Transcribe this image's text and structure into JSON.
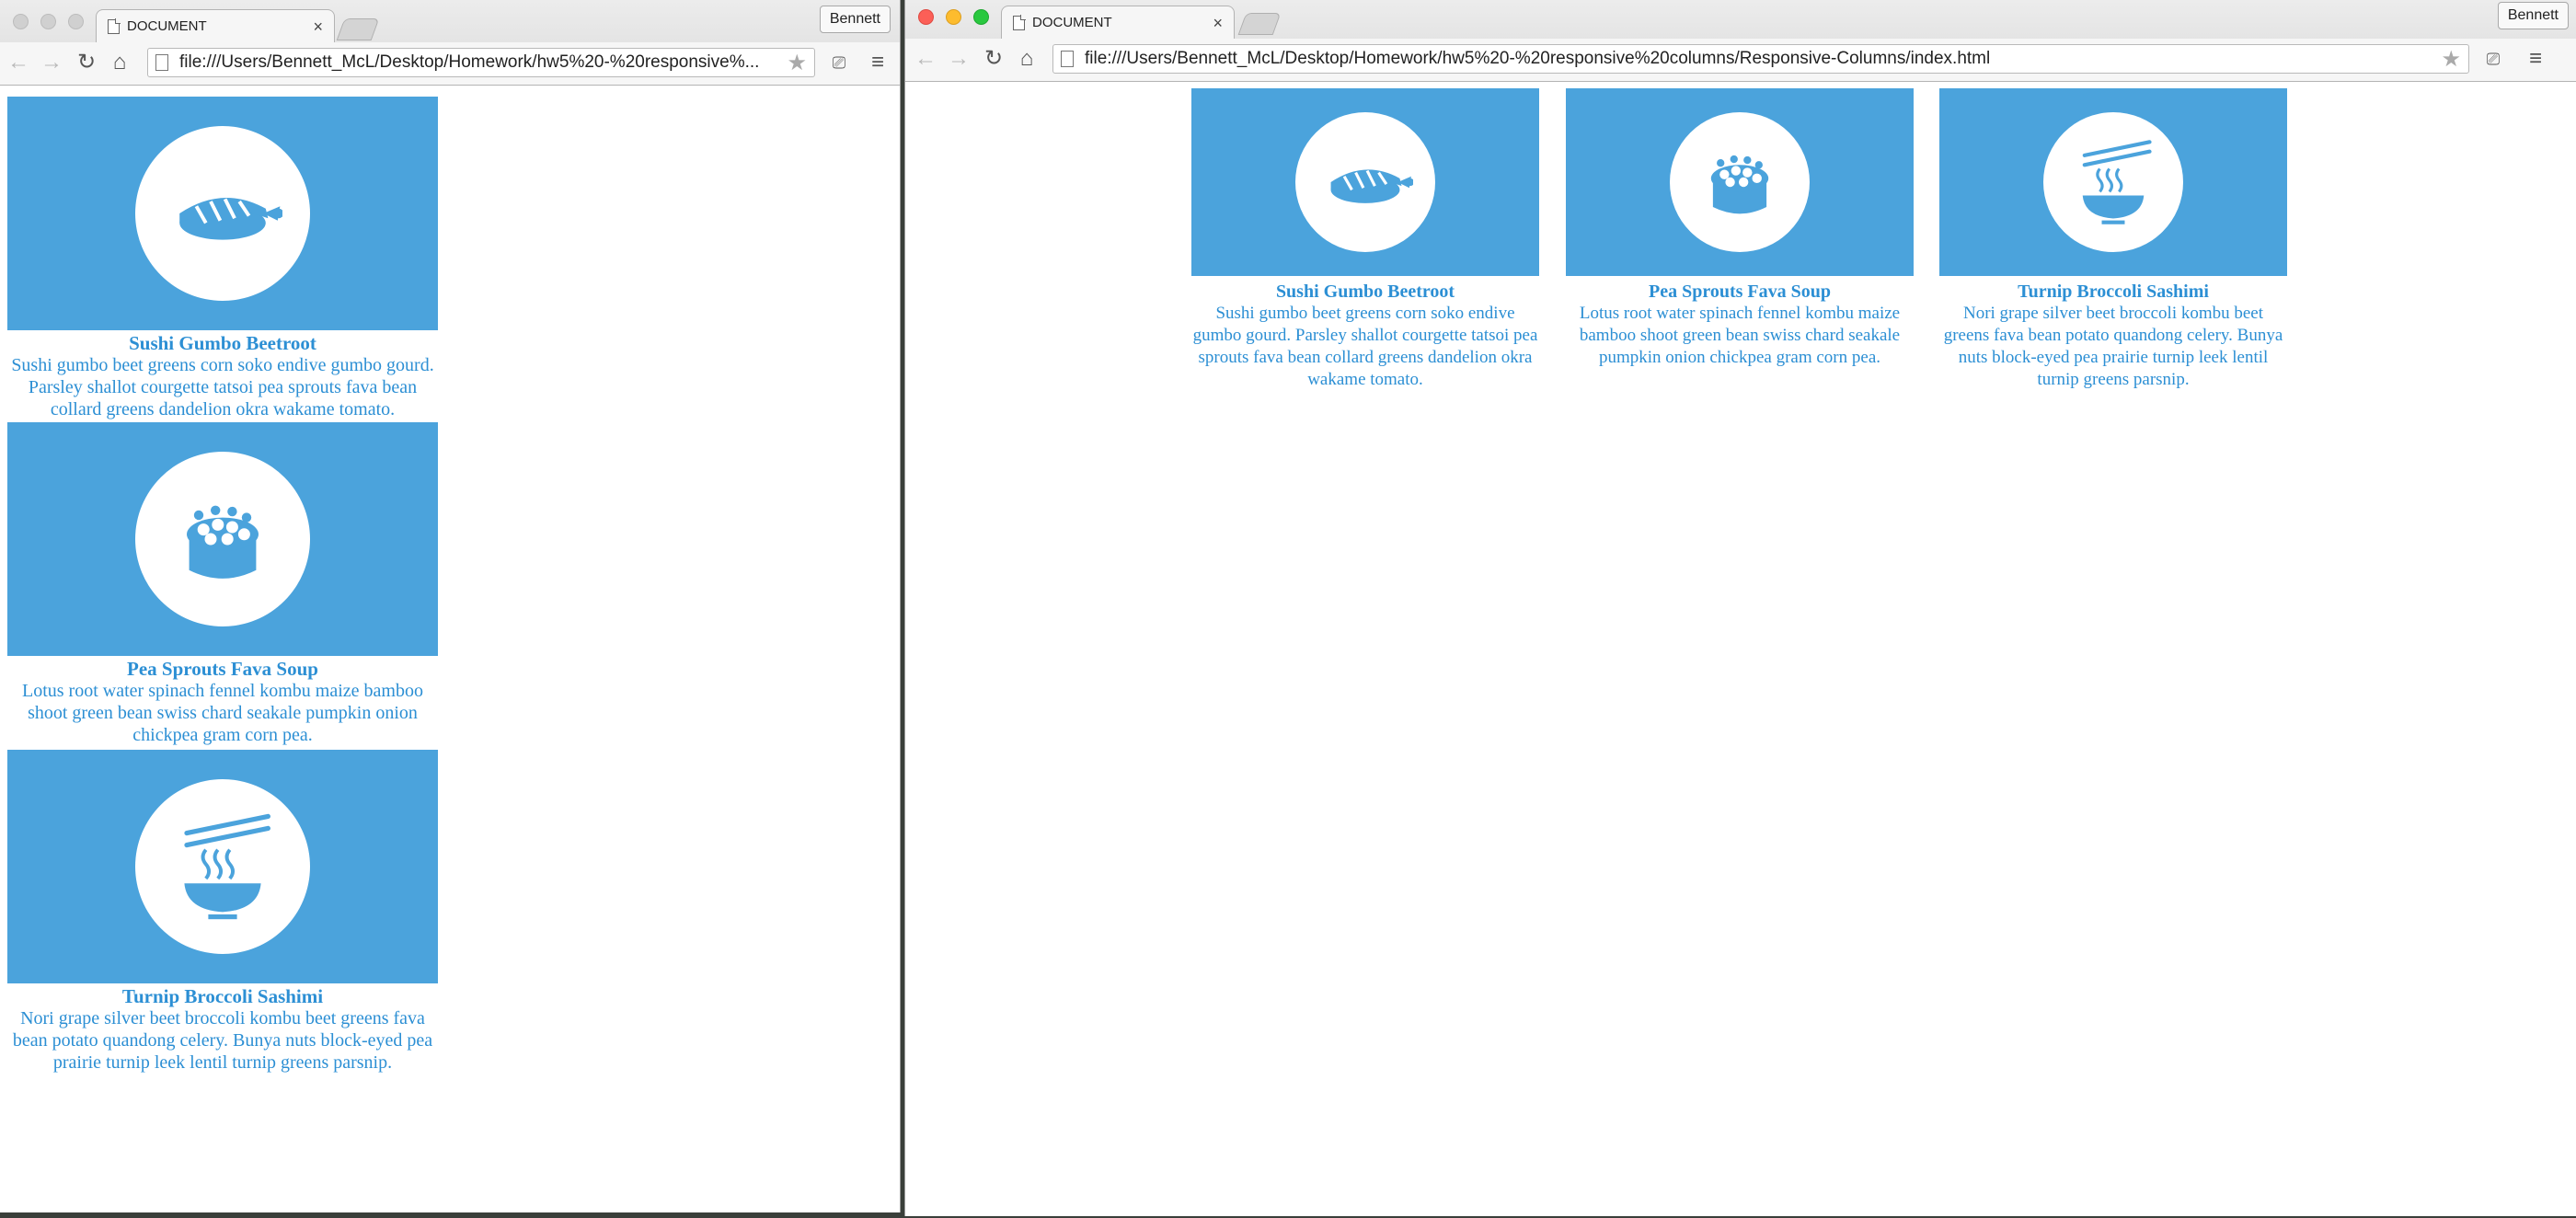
{
  "colors": {
    "accent": "#2c8fd4",
    "card_bg": "#4ba3dc",
    "circle": "#ffffff"
  },
  "left_window": {
    "tab_title": "DOCUMENT",
    "profile": "Bennett",
    "url": "file:///Users/Bennett_McL/Desktop/Homework/hw5%20-%20responsive%..."
  },
  "right_window": {
    "tab_title": "DOCUMENT",
    "profile": "Bennett",
    "url": "file:///Users/Bennett_McL/Desktop/Homework/hw5%20-%20responsive%20columns/Responsive-Columns/index.html"
  },
  "cards": [
    {
      "icon": "sushi-icon",
      "title": "Sushi Gumbo Beetroot",
      "description": "Sushi gumbo beet greens corn soko endive gumbo gourd. Parsley shallot courgette tatsoi pea sprouts fava bean collard greens dandelion okra wakame tomato."
    },
    {
      "icon": "roe-sushi-icon",
      "title": "Pea Sprouts Fava Soup",
      "description": "Lotus root water spinach fennel kombu maize bamboo shoot green bean swiss chard seakale pumpkin onion chickpea gram corn pea."
    },
    {
      "icon": "noodle-bowl-icon",
      "title": "Turnip Broccoli Sashimi",
      "description": "Nori grape silver beet broccoli kombu beet greens fava bean potato quandong celery. Bunya nuts block-eyed pea prairie turnip leek lentil turnip greens parsnip."
    }
  ]
}
